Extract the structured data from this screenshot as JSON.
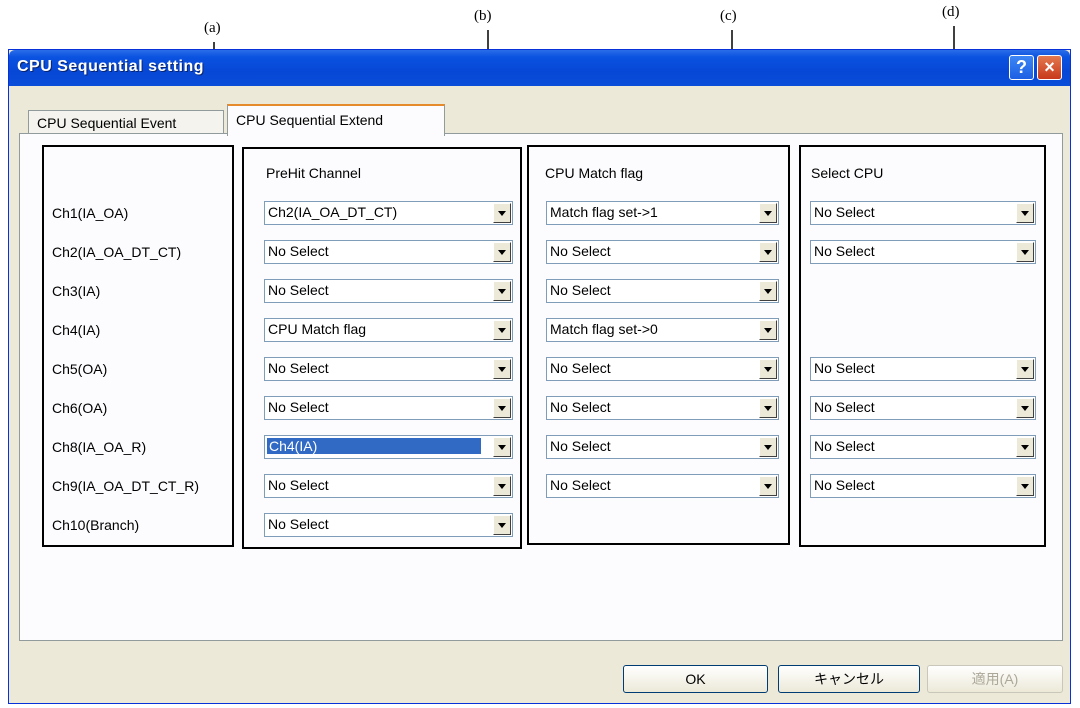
{
  "annotations": [
    "(a)",
    "(b)",
    "(c)",
    "(d)"
  ],
  "dialog": {
    "title": "CPU Sequential setting",
    "help_label": "?",
    "close_label": "×"
  },
  "tabs": [
    "CPU Sequential Event",
    "CPU Sequential Extend"
  ],
  "active_tab": "CPU Sequential Extend",
  "columns": {
    "prehit_header": "PreHit Channel",
    "match_header": "CPU Match flag",
    "cpu_header": "Select CPU"
  },
  "channels": [
    "Ch1(IA_OA)",
    "Ch2(IA_OA_DT_CT)",
    "Ch3(IA)",
    "Ch4(IA)",
    "Ch5(OA)",
    "Ch6(OA)",
    "Ch8(IA_OA_R)",
    "Ch9(IA_OA_DT_CT_R)",
    "Ch10(Branch)"
  ],
  "prehit": [
    "Ch2(IA_OA_DT_CT)",
    "No Select",
    "No Select",
    "CPU Match flag",
    "No Select",
    "No Select",
    "Ch4(IA)",
    "No Select",
    "No Select"
  ],
  "match_flag": [
    "Match flag set->1",
    "No Select",
    "No Select",
    "Match flag set->0",
    "No Select",
    "No Select",
    "No Select",
    "No Select"
  ],
  "select_cpu": [
    "No Select",
    "No Select",
    "No Select",
    "No Select",
    "No Select",
    "No Select"
  ],
  "buttons": {
    "ok": "OK",
    "cancel": "キャンセル",
    "apply": "適用(A)"
  }
}
